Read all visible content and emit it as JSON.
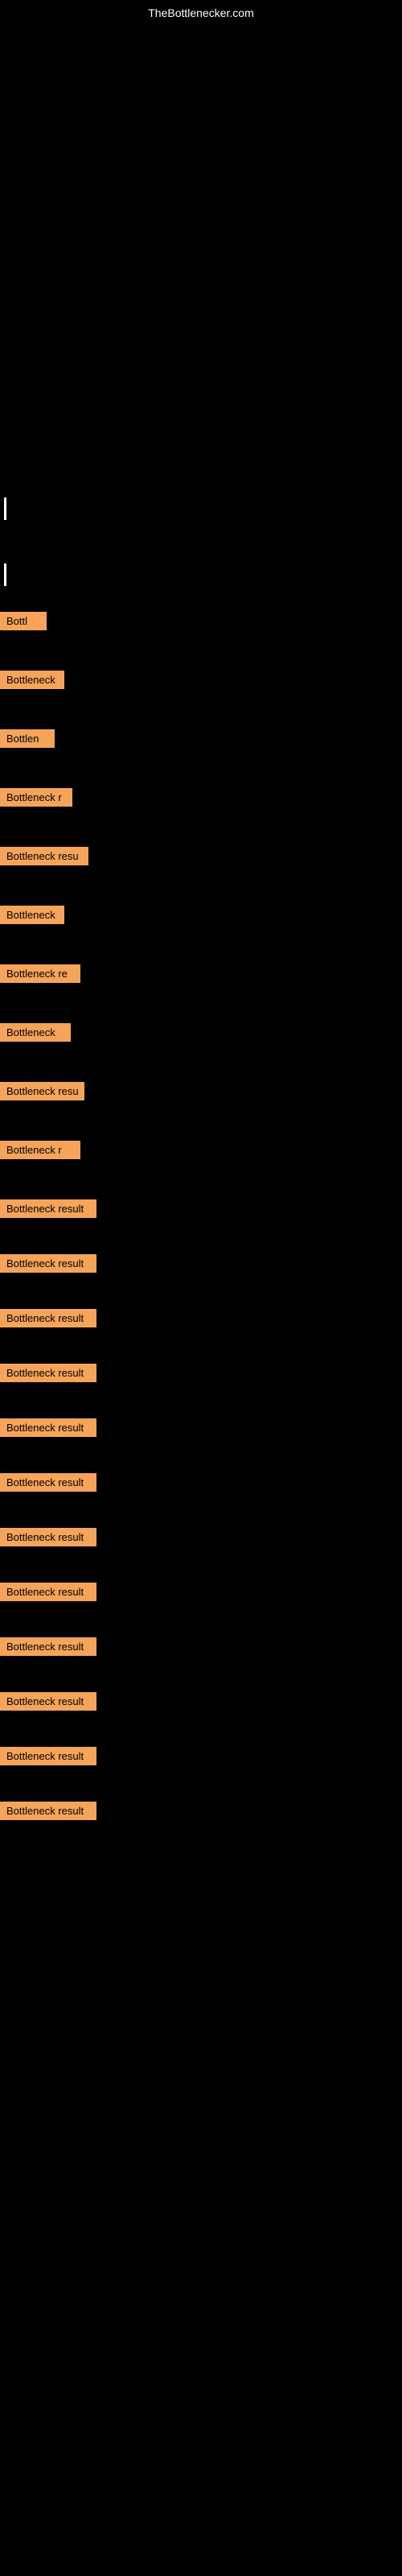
{
  "site": {
    "title": "TheBottlenecker.com"
  },
  "items": [
    {
      "id": 1,
      "label": "Bottl",
      "width": 58
    },
    {
      "id": 2,
      "label": "Bottleneck",
      "width": 80
    },
    {
      "id": 3,
      "label": "Bottlen",
      "width": 68
    },
    {
      "id": 4,
      "label": "Bottleneck r",
      "width": 90
    },
    {
      "id": 5,
      "label": "Bottleneck resu",
      "width": 110
    },
    {
      "id": 6,
      "label": "Bottleneck",
      "width": 80
    },
    {
      "id": 7,
      "label": "Bottleneck re",
      "width": 100
    },
    {
      "id": 8,
      "label": "Bottleneck",
      "width": 88
    },
    {
      "id": 9,
      "label": "Bottleneck resu",
      "width": 105
    },
    {
      "id": 10,
      "label": "Bottleneck r",
      "width": 100
    },
    {
      "id": 11,
      "label": "Bottleneck result",
      "width": 120
    },
    {
      "id": 12,
      "label": "Bottleneck result",
      "width": 120
    },
    {
      "id": 13,
      "label": "Bottleneck result",
      "width": 120
    },
    {
      "id": 14,
      "label": "Bottleneck result",
      "width": 120
    },
    {
      "id": 15,
      "label": "Bottleneck result",
      "width": 120
    },
    {
      "id": 16,
      "label": "Bottleneck result",
      "width": 120
    },
    {
      "id": 17,
      "label": "Bottleneck result",
      "width": 120
    },
    {
      "id": 18,
      "label": "Bottleneck result",
      "width": 120
    },
    {
      "id": 19,
      "label": "Bottleneck result",
      "width": 120
    },
    {
      "id": 20,
      "label": "Bottleneck result",
      "width": 120
    },
    {
      "id": 21,
      "label": "Bottleneck result",
      "width": 120
    },
    {
      "id": 22,
      "label": "Bottleneck result",
      "width": 120
    }
  ],
  "colors": {
    "background": "#000000",
    "badge": "#f5a45a",
    "text_light": "#ffffff",
    "text_dark": "#000000"
  }
}
